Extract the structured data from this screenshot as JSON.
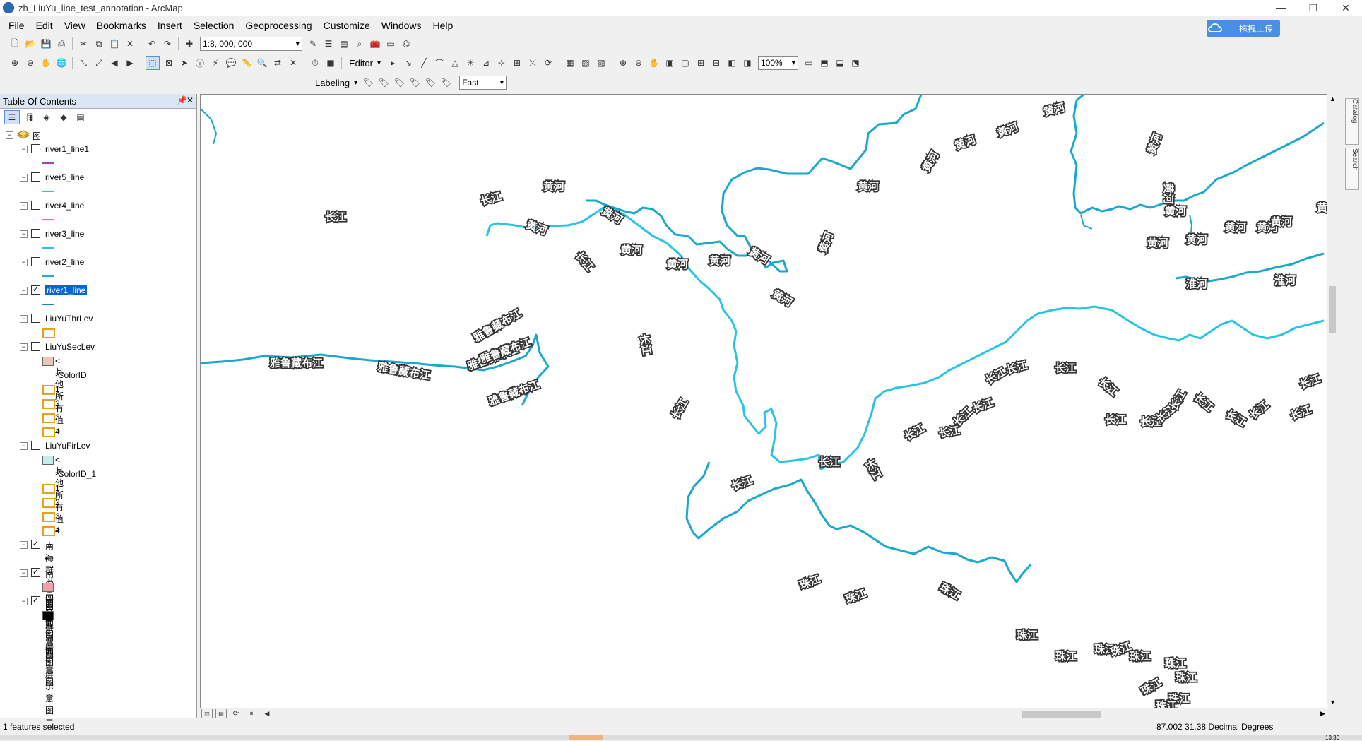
{
  "window": {
    "title": "zh_LiuYu_line_test_annotation - ArcMap",
    "minimize_icon": "minimize-icon",
    "maximize_icon": "maximize-icon",
    "close_icon": "close-icon"
  },
  "upload": {
    "label": "拖拽上传"
  },
  "menu": [
    "File",
    "Edit",
    "View",
    "Bookmarks",
    "Insert",
    "Selection",
    "Geoprocessing",
    "Customize",
    "Windows",
    "Help"
  ],
  "toolbar": {
    "scale": "1:8, 000, 000",
    "editor": "Editor",
    "zoom": "100%",
    "labeling": "Labeling",
    "quality": "Fast"
  },
  "toc": {
    "title": "Table Of Contents",
    "root": "图层",
    "layers": [
      {
        "name": "river1_line1",
        "checked": false,
        "symbol": "line",
        "color": "#a040c0"
      },
      {
        "name": "river5_line",
        "checked": false,
        "symbol": "line",
        "color": "#30c0e0"
      },
      {
        "name": "river4_line",
        "checked": false,
        "symbol": "line",
        "color": "#30c0e0"
      },
      {
        "name": "river3_line",
        "checked": false,
        "symbol": "line",
        "color": "#30c0e0"
      },
      {
        "name": "river2_line",
        "checked": false,
        "symbol": "line",
        "color": "#30a0e0"
      },
      {
        "name": "river1_line",
        "checked": true,
        "symbol": "line",
        "color": "#1f7fd6",
        "selected": true
      },
      {
        "name": "LiuYuThrLev",
        "checked": false,
        "symbol": "box",
        "color": "#e8a020"
      },
      {
        "name": "LiuYuSecLev",
        "checked": false,
        "symbol": "none"
      },
      {
        "name": "<其他所有值>",
        "sub": true,
        "symbol": "box-fill",
        "color": "#e8c8b8"
      },
      {
        "name": "ColorID",
        "sub": true,
        "header": true
      },
      {
        "name": "1",
        "sub": true,
        "symbol": "box",
        "color": "#e8a020"
      },
      {
        "name": "2",
        "sub": true,
        "symbol": "box",
        "color": "#e8a020"
      },
      {
        "name": "3",
        "sub": true,
        "symbol": "box",
        "color": "#e8a020"
      },
      {
        "name": "4",
        "sub": true,
        "symbol": "box",
        "color": "#e8a020"
      },
      {
        "name": "LiuYuFirLev",
        "checked": false,
        "symbol": "none"
      },
      {
        "name": "<其他所有值>",
        "sub": true,
        "symbol": "box-fill",
        "color": "#c8ece8"
      },
      {
        "name": "ColorID_1",
        "sub": true,
        "header": true
      },
      {
        "name": "1",
        "sub": true,
        "symbol": "box",
        "color": "#e8a020"
      },
      {
        "name": "2",
        "sub": true,
        "symbol": "box",
        "color": "#e8a020"
      },
      {
        "name": "3",
        "sub": true,
        "symbol": "box",
        "color": "#e8a020"
      },
      {
        "name": "4",
        "sub": true,
        "symbol": "box",
        "color": "#e8a020"
      },
      {
        "name": "南海群岛点图层示意图",
        "checked": true,
        "symbol": "dot",
        "color": "#000000"
      },
      {
        "name": "南海国界面图层示意图一",
        "checked": true,
        "symbol": "box-fill",
        "color": "#f0a0a8"
      },
      {
        "name": "南海群岛面图层示意图二",
        "checked": true,
        "symbol": "box-fill",
        "color": "#000000"
      }
    ]
  },
  "map": {
    "labels": {
      "changjiang": "长江",
      "huanghe": "黄河",
      "yarlung": "雅鲁藏布江",
      "huaihe": "淮河",
      "zhujiang": "珠江"
    },
    "river_color": "#29c4e4",
    "river_dark": "#1aa8cc"
  },
  "right_tabs": [
    "Catalog",
    "Search"
  ],
  "status": {
    "message": "1 features selected",
    "coords": "87.002  31.38 Decimal Degrees",
    "tiny": "13:30"
  }
}
